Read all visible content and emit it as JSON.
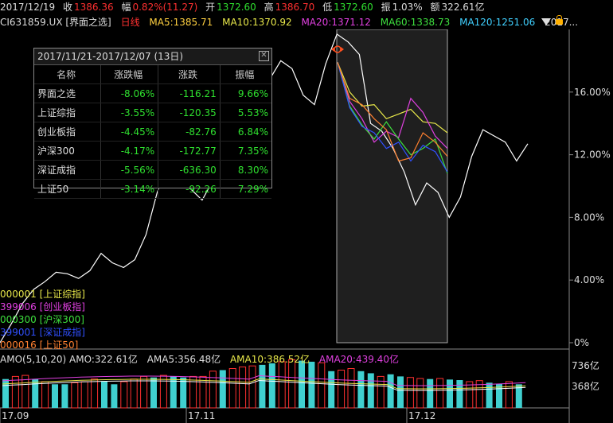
{
  "topbar": {
    "date": "2017/12/19",
    "close_label": "收",
    "close": "1386.36",
    "chg_label": "幅",
    "chg": "0.82%(11.27)",
    "open_label": "开",
    "open": "1372.60",
    "high_label": "高",
    "high": "1386.70",
    "low_label": "低",
    "low": "1372.60",
    "amp_label": "振",
    "amp": "1.03%",
    "amt_label": "额",
    "amt": "322.61亿"
  },
  "mabar": {
    "code": "CI631859.UX [界面之选]",
    "period": "日线",
    "ma5": "MA5:1385.71",
    "ma10": "MA10:1370.92",
    "ma20": "MA20:1371.12",
    "ma60": "MA60:1338.73",
    "ma120": "MA120:1251.06",
    "more": "2017..."
  },
  "popup": {
    "title": "2017/11/21-2017/12/07 (13日)",
    "headers": [
      "名称",
      "涨跌幅",
      "涨跌",
      "振幅"
    ],
    "rows": [
      {
        "name": "界面之选",
        "pct": "-8.06%",
        "chg": "-116.21",
        "amp": "9.66%"
      },
      {
        "name": "上证综指",
        "pct": "-3.55%",
        "chg": "-120.35",
        "amp": "5.53%"
      },
      {
        "name": "创业板指",
        "pct": "-4.45%",
        "chg": "-82.76",
        "amp": "6.84%"
      },
      {
        "name": "沪深300",
        "pct": "-4.17%",
        "chg": "-172.77",
        "amp": "7.35%"
      },
      {
        "name": "深证成指",
        "pct": "-5.56%",
        "chg": "-636.30",
        "amp": "8.30%"
      },
      {
        "name": "上证50",
        "pct": "-3.14%",
        "chg": "-92.26",
        "amp": "7.29%"
      }
    ]
  },
  "legend": [
    {
      "text": "000001 [上证综指]",
      "color": "#e8e84a"
    },
    {
      "text": "399006 [创业板指]",
      "color": "#e040e0"
    },
    {
      "text": "000300 [沪深300]",
      "color": "#3ee03e"
    },
    {
      "text": "399001 [深证成指]",
      "color": "#3050ff"
    },
    {
      "text": "000016 [上证50]",
      "color": "#ff8030"
    }
  ],
  "yaxis": [
    "16.00%",
    "12.00%",
    "8.00%",
    "4.00%",
    "0%"
  ],
  "xaxis": [
    "17.09",
    "17.11",
    "17.12"
  ],
  "amo": {
    "label": "AMO(5,10,20)",
    "amo": "AMO:322.61亿",
    "ama5": "AMA5:356.48亿",
    "ama10": "AMA10:386.52亿",
    "ama20": "AMA20:439.40亿",
    "y1": "736亿",
    "y2": "368亿"
  },
  "colors": {
    "up": "#ff3030",
    "down": "#2fe02f",
    "cyan": "#40d0d0",
    "ma5": "#ffffff",
    "ma10": "#e8e84a",
    "ma20": "#e040e0",
    "ma60": "#3ee03e",
    "ma120": "#40d0ff"
  },
  "chart_data": {
    "type": "line",
    "series": [
      {
        "name": "界面之选",
        "values": [
          0,
          1.2,
          2.5,
          3.4,
          3.9,
          4.5,
          4.4,
          4.1,
          4.6,
          5.7,
          5.1,
          4.8,
          5.3,
          6.9,
          9.6,
          11.6,
          10.2,
          9.8,
          9.1,
          10.4,
          12.4,
          15.5,
          14.1,
          13.5,
          16.8,
          18.0,
          17.5,
          15.8,
          15.2,
          17.8,
          19.7,
          19.2,
          18.4,
          14.0,
          13.5,
          12.4,
          10.9,
          8.8,
          10.2,
          9.6,
          8.0,
          9.3,
          11.9,
          13.6,
          13.2,
          12.8,
          11.6,
          12.7
        ]
      },
      {
        "name": "上证综指",
        "values": [
          17.9,
          16.0,
          15.1,
          15.2,
          14.3,
          14.6,
          14.9,
          14.1,
          14.0,
          13.4
        ]
      },
      {
        "name": "创业板指",
        "values": [
          17.9,
          15.4,
          14.3,
          12.8,
          13.5,
          13.1,
          15.6,
          14.7,
          13.2,
          12.4
        ]
      },
      {
        "name": "沪深300",
        "values": [
          17.9,
          15.1,
          13.9,
          13.0,
          14.1,
          13.0,
          12.0,
          12.4,
          13.0,
          10.8
        ]
      },
      {
        "name": "深证成指",
        "values": [
          17.9,
          15.0,
          13.8,
          13.4,
          12.4,
          12.8,
          11.6,
          12.6,
          12.2,
          10.9
        ]
      },
      {
        "name": "上证50",
        "values": [
          17.9,
          15.6,
          15.2,
          14.3,
          13.6,
          11.6,
          11.8,
          13.4,
          12.8,
          11.9
        ]
      }
    ],
    "ylim": [
      0,
      20
    ]
  }
}
